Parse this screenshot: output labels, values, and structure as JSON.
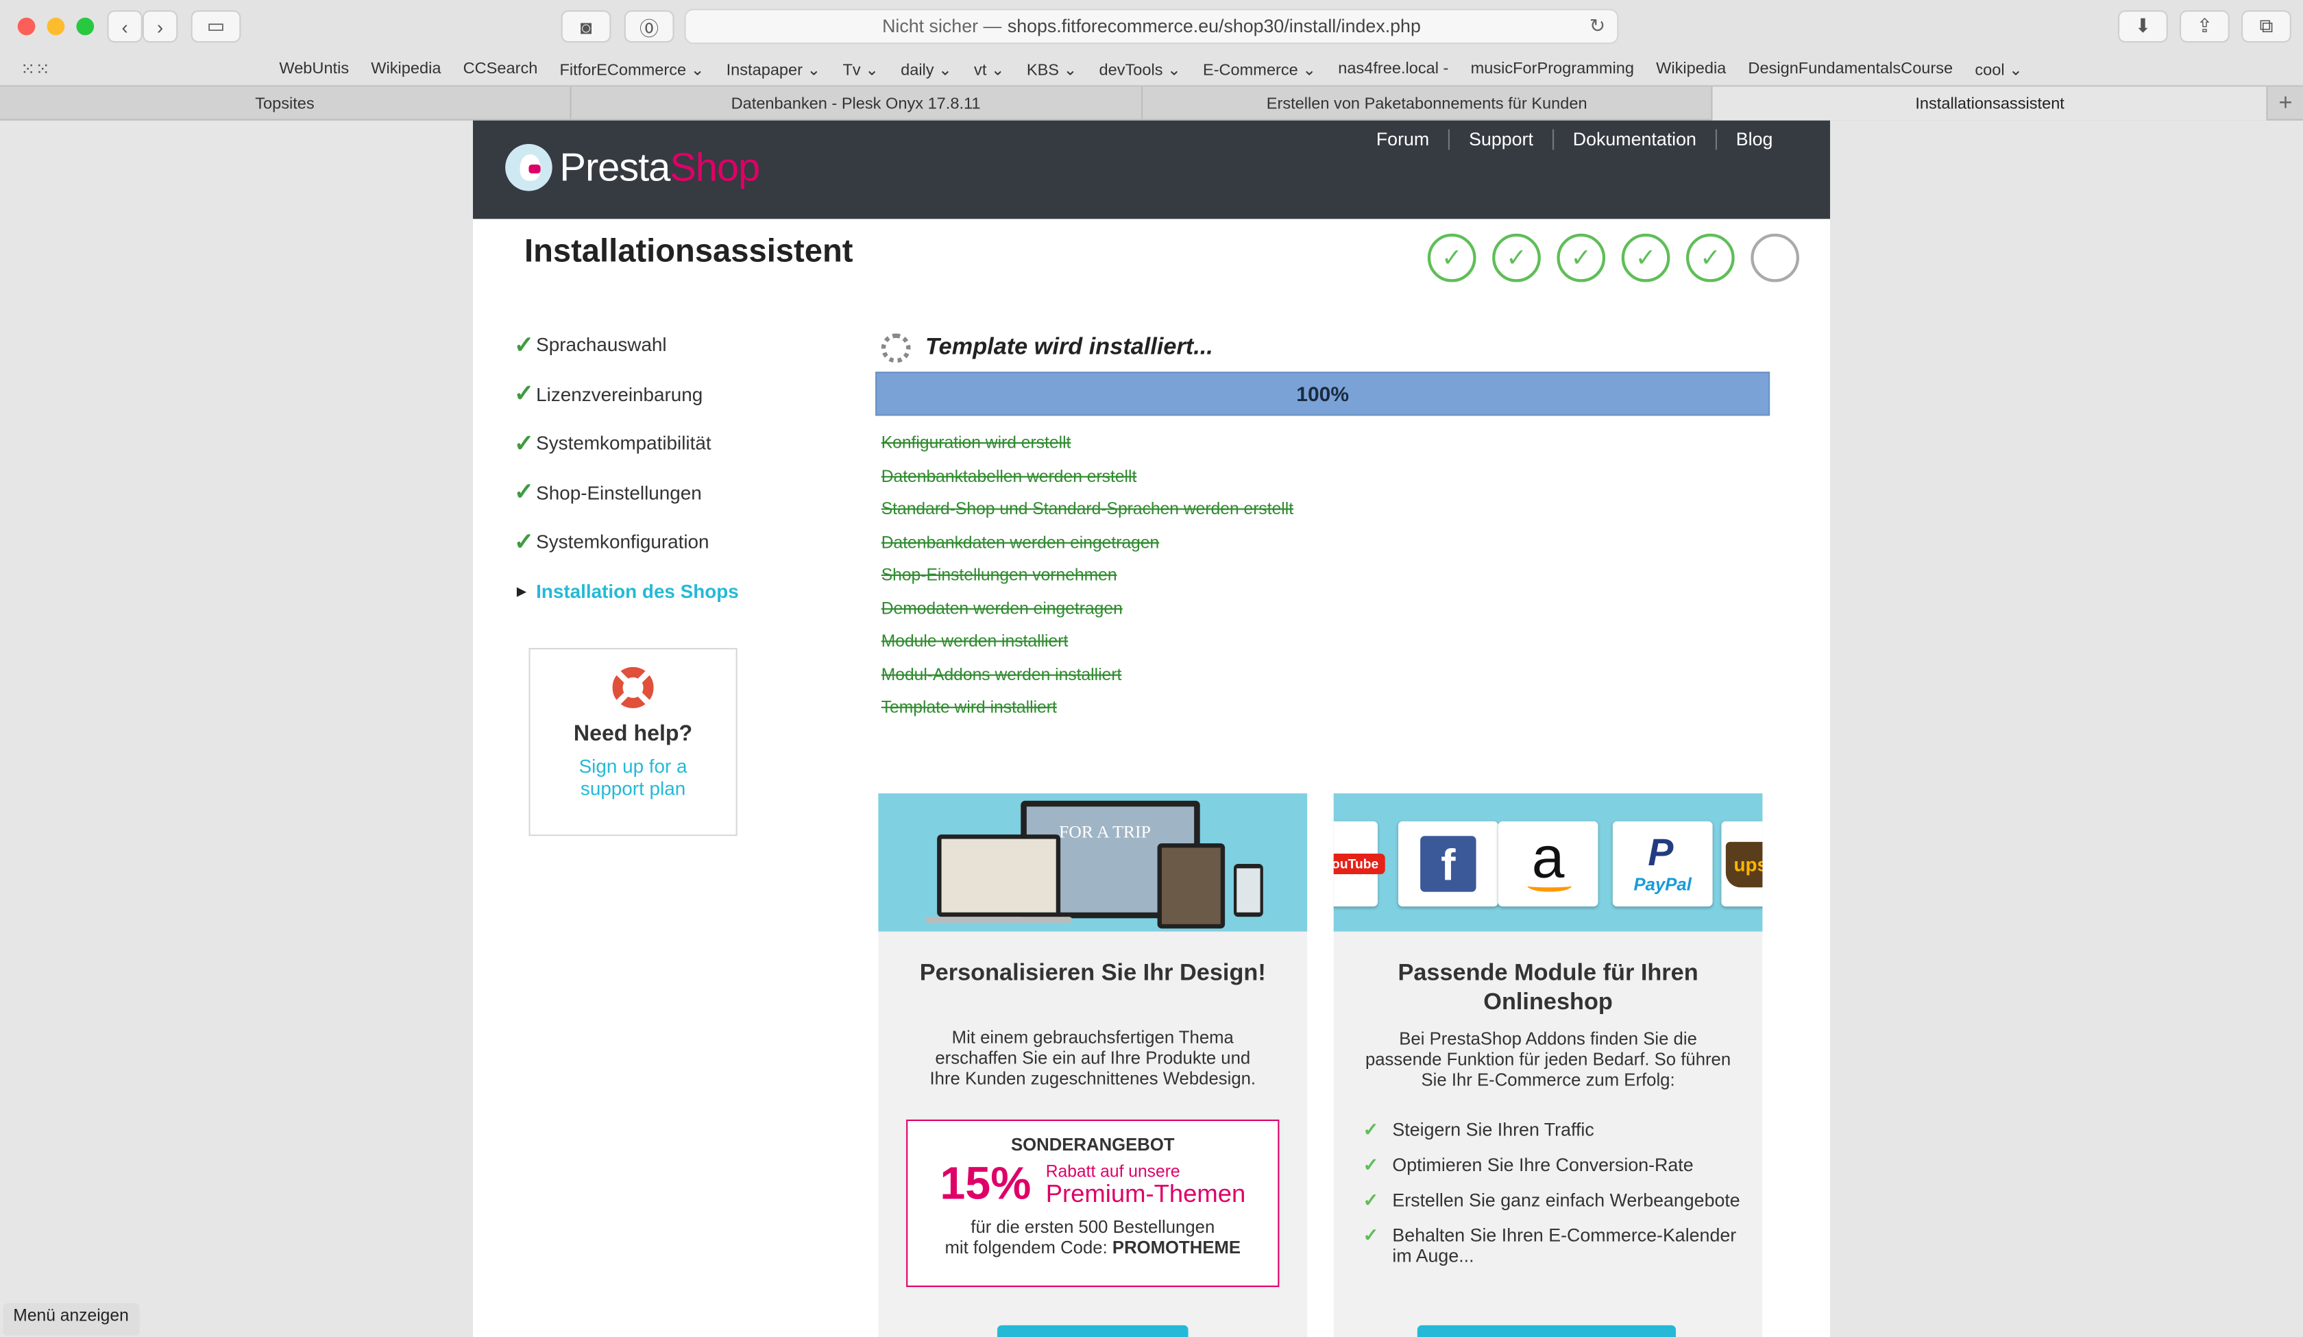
{
  "browser": {
    "url_prefix": "Nicht sicher —",
    "url": "shops.fitforecommerce.eu/shop30/install/index.php",
    "bookmarks": [
      "WebUntis",
      "Wikipedia",
      "CCSearch",
      "FitforECommerce ⌄",
      "Instapaper ⌄",
      "Tv ⌄",
      "daily ⌄",
      "vt ⌄",
      "KBS ⌄",
      "devTools ⌄",
      "E-Commerce ⌄",
      "nas4free.local -",
      "musicForProgramming",
      "Wikipedia",
      "DesignFundamentalsCourse",
      "cool ⌄"
    ],
    "tabs": [
      "Topsites",
      "Datenbanken - Plesk Onyx 17.8.11",
      "Erstellen von Paketabonnements für Kunden",
      "Installationsassistent"
    ],
    "status_button": "Menü anzeigen"
  },
  "header": {
    "logo_part1": "Presta",
    "logo_part2": "Shop",
    "nav": [
      "Forum",
      "Support",
      "Dokumentation",
      "Blog"
    ]
  },
  "page_title": "Installationsassistent",
  "steps": {
    "completed": 5,
    "total": 6,
    "check_glyph": "✓"
  },
  "sidebar": {
    "items": [
      {
        "label": "Sprachauswahl",
        "state": "done"
      },
      {
        "label": "Lizenzvereinbarung",
        "state": "done"
      },
      {
        "label": "Systemkompatibilität",
        "state": "done"
      },
      {
        "label": "Shop-Einstellungen",
        "state": "done"
      },
      {
        "label": "Systemkonfiguration",
        "state": "done"
      },
      {
        "label": "Installation des Shops",
        "state": "current"
      }
    ]
  },
  "help": {
    "title": "Need help?",
    "link": "Sign up for a support plan"
  },
  "progress": {
    "title": "Template wird installiert...",
    "percent_label": "100%",
    "percent": 100,
    "log": [
      "Konfiguration wird erstellt",
      "Datenbanktabellen werden erstellt",
      "Standard-Shop und Standard-Sprachen werden erstellt",
      "Datenbankdaten werden eingetragen",
      "Shop-Einstellungen vornehmen",
      "Demodaten werden eingetragen",
      "Module werden installiert",
      "Modul-Addons werden installiert",
      "Template wird installiert"
    ]
  },
  "card_design": {
    "title": "Personalisieren Sie Ihr Design!",
    "text": "Mit einem gebrauchsfertigen Thema erschaffen Sie ein auf Ihre Produkte und Ihre Kunden zugeschnittenes Webdesign.",
    "offer_heading": "SONDERANGEBOT",
    "offer_percent": "15%",
    "offer_small": "Rabatt auf unsere",
    "offer_big": "Premium-Themen",
    "offer_foot1": "für die ersten 500 Bestellungen",
    "offer_foot2": "mit folgendem Code:",
    "offer_code": "PROMOTHEME",
    "banner_text": "FOR A TRIP"
  },
  "card_modules": {
    "title": "Passende Module für Ihren Onlineshop",
    "text": "Bei PrestaShop Addons finden Sie die passende Funktion für jeden Bedarf. So führen Sie Ihr E-Commerce zum Erfolg:",
    "features": [
      "Steigern Sie Ihren Traffic",
      "Optimieren Sie Ihre Conversion-Rate",
      "Erstellen Sie ganz einfach Werbeangebote",
      "Behalten Sie Ihren E-Commerce-Kalender im Auge..."
    ],
    "brands": [
      "YouTube",
      "f",
      "a",
      "PayPal",
      "ups"
    ]
  }
}
